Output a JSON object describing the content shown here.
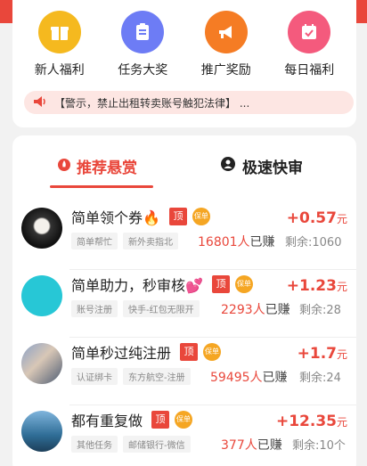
{
  "quick_icons": [
    {
      "label": "新人福利",
      "icon": "gift-icon",
      "color": "#f5b91f"
    },
    {
      "label": "任务大奖",
      "icon": "clipboard-icon",
      "color": "#6d7cf5"
    },
    {
      "label": "推广奖励",
      "icon": "megaphone-icon",
      "color": "#f57c24"
    },
    {
      "label": "每日福利",
      "icon": "calendar-icon",
      "color": "#f45a7d"
    }
  ],
  "notice": {
    "text": "【警示，禁止出租转卖账号触犯法律】 ..."
  },
  "tabs": [
    {
      "label": "推荐悬赏",
      "active": true
    },
    {
      "label": "极速快审",
      "active": false
    }
  ],
  "tasks": [
    {
      "title": "简单领个券🔥",
      "ding": "顶",
      "bao": "保单",
      "tags": [
        "简单帮忙",
        "新外卖指北"
      ],
      "earned_count": "16801人",
      "earned_suffix": "已赚",
      "remaining": "剩余:1060",
      "reward": "+0.57",
      "unit": "元"
    },
    {
      "title": "简单助力，秒审核💕",
      "ding": "顶",
      "bao": "保单",
      "tags": [
        "账号注册",
        "快手-红包无限开"
      ],
      "earned_count": "2293人",
      "earned_suffix": "已赚",
      "remaining": "剩余:28",
      "reward": "+1.23",
      "unit": "元"
    },
    {
      "title": "简单秒过纯注册",
      "ding": "顶",
      "bao": "保单",
      "tags": [
        "认证绑卡",
        "东方航空-注册"
      ],
      "earned_count": "59495人",
      "earned_suffix": "已赚",
      "remaining": "剩余:24",
      "reward": "+1.7",
      "unit": "元"
    },
    {
      "title": "都有重复做",
      "ding": "顶",
      "bao": "保单",
      "tags": [
        "其他任务",
        "邮储银行-微信"
      ],
      "earned_count": "377人",
      "earned_suffix": "已赚",
      "remaining": "剩余:10个",
      "reward": "+12.35",
      "unit": "元"
    }
  ],
  "colors": {
    "accent": "#e9473b"
  }
}
